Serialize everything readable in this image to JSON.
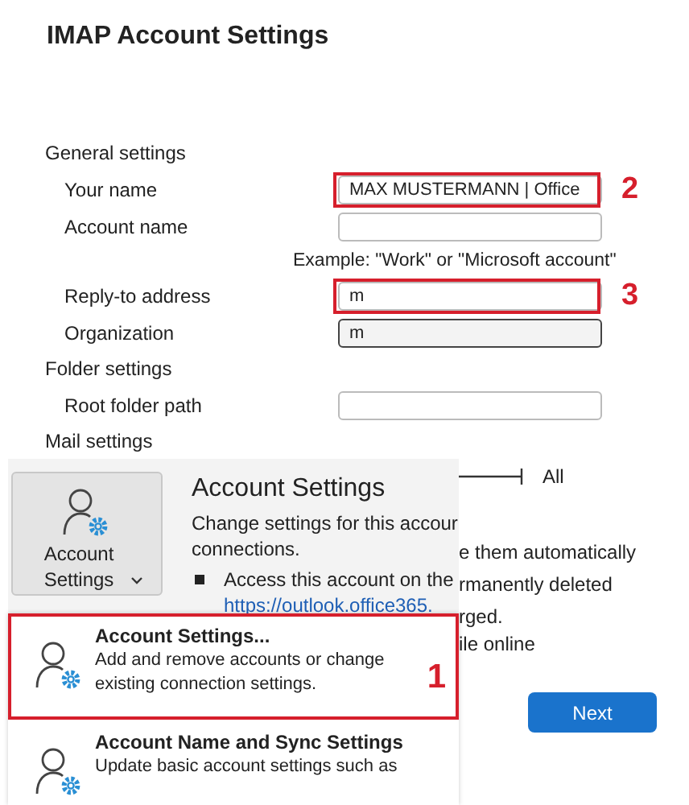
{
  "dialog": {
    "title": "IMAP Account Settings",
    "sections": [
      {
        "heading": "General settings",
        "fields": [
          {
            "label": "Your name",
            "value": "MAX MUSTERMANN | Office",
            "focused": false,
            "callout": "2"
          },
          {
            "label": "Account name",
            "focused": false,
            "note": "Example: \"Work\" or \"Microsoft account\""
          },
          {
            "label": "Reply-to address",
            "value": "m",
            "focused": false,
            "callout": "3"
          },
          {
            "label": "Organization",
            "value": "m",
            "focused": true
          }
        ]
      },
      {
        "heading": "Folder settings",
        "fields": [
          {
            "label": "Root folder path",
            "focused": false
          }
        ]
      },
      {
        "heading": "Mail settings"
      }
    ],
    "slider_label": "All",
    "partial_lines": [
      "e them automatically",
      "rmanently deleted",
      "rged.",
      "ile online"
    ],
    "next_button": "Next"
  },
  "account_panel": {
    "button_label": "Account Settings",
    "heading": "Account Settings",
    "description_lines": [
      "Change settings for this accour",
      "connections."
    ],
    "bullet": "Access this account on the",
    "link": "https://outlook.office365.",
    "menu": [
      {
        "title": "Account Settings...",
        "description": "Add and remove accounts or change existing connection settings.",
        "callout": "1"
      },
      {
        "title": "Account Name and Sync Settings",
        "description": "Update basic account settings such as"
      }
    ]
  }
}
